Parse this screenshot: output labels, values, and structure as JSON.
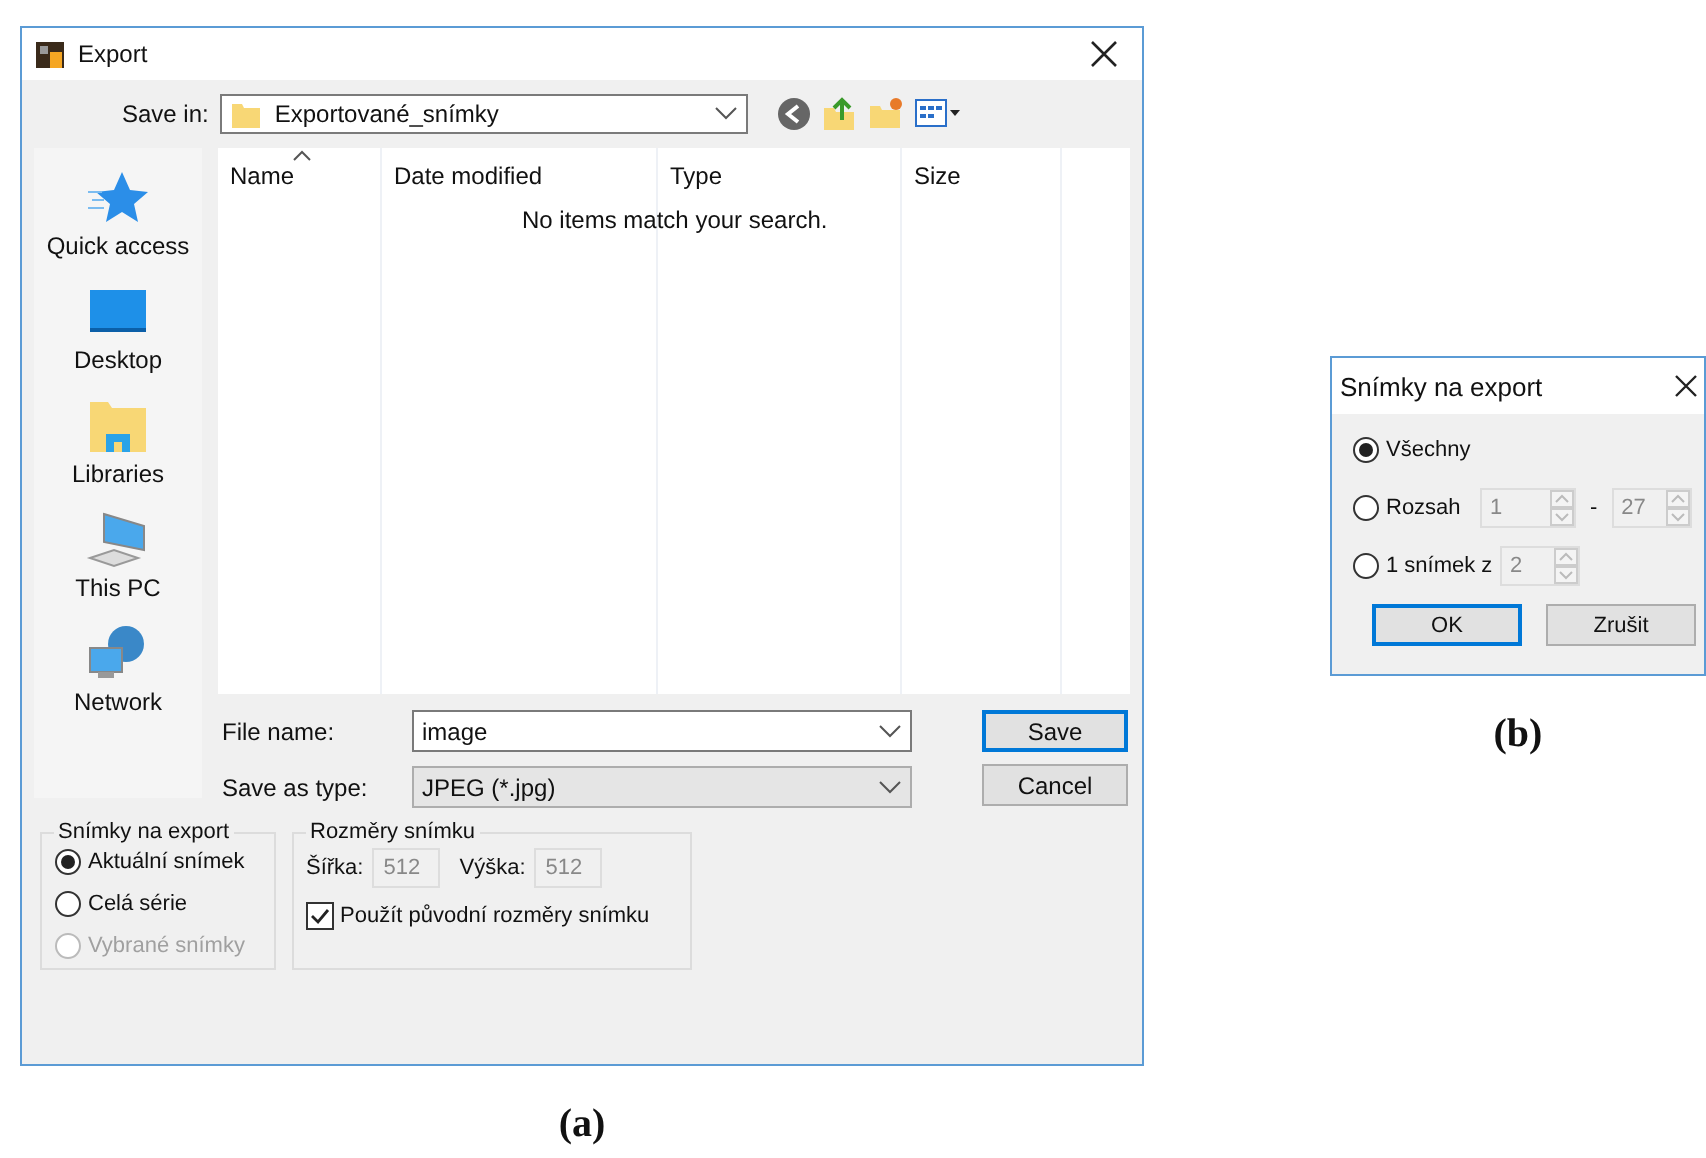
{
  "dialog_a": {
    "title": "Export",
    "save_in": {
      "label": "Save in:",
      "value": "Exportované_snímky"
    },
    "places": [
      {
        "label": "Quick access"
      },
      {
        "label": "Desktop"
      },
      {
        "label": "Libraries"
      },
      {
        "label": "This PC"
      },
      {
        "label": "Network"
      }
    ],
    "columns": [
      "Name",
      "Date modified",
      "Type",
      "Size"
    ],
    "empty_message": "No items match your search.",
    "file_name": {
      "label": "File name:",
      "value": "image"
    },
    "save_as_type": {
      "label": "Save as type:",
      "value": "JPEG (*.jpg)"
    },
    "buttons": [
      {
        "label": "Save",
        "default": true
      },
      {
        "label": "Cancel",
        "default": false
      }
    ],
    "export_group": {
      "title": "Snímky na export",
      "options": [
        {
          "label": "Aktuální snímek",
          "selected": true,
          "disabled": false
        },
        {
          "label": "Celá série",
          "selected": false,
          "disabled": false
        },
        {
          "label": "Vybrané snímky",
          "selected": false,
          "disabled": true
        }
      ]
    },
    "size_group": {
      "title": "Rozměry snímku",
      "width": {
        "label": "Šířka:",
        "value": "512"
      },
      "height": {
        "label": "Výška:",
        "value": "512"
      },
      "keep_original": {
        "label": "Použít původní rozměry snímku",
        "checked": true
      }
    }
  },
  "caption_a": "(a)",
  "dialog_b": {
    "title": "Snímky na export",
    "options": [
      {
        "label": "Všechny",
        "selected": true
      },
      {
        "label": "Rozsah",
        "selected": false,
        "fields": [
          "1",
          "27"
        ],
        "separator": "-"
      },
      {
        "label": "1 snímek z",
        "selected": false,
        "fields": [
          "2"
        ]
      }
    ],
    "buttons": [
      {
        "label": "OK",
        "default": true
      },
      {
        "label": "Zrušit",
        "default": false
      }
    ]
  },
  "caption_b": "(b)"
}
